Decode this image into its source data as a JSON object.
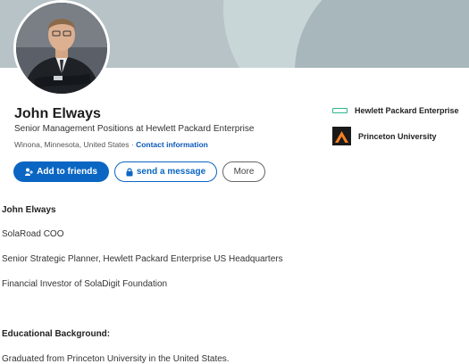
{
  "profile": {
    "name": "John Elways",
    "headline": "Senior Management Positions at Hewlett Packard Enterprise",
    "location": "Winona, Minnesota, United States",
    "separator": " · ",
    "contact_link": "Contact information"
  },
  "actions": {
    "add_friends": "Add to friends",
    "send_message": "send a message",
    "more": "More"
  },
  "sidebar": {
    "items": [
      {
        "label": "Hewlett Packard Enterprise",
        "icon": "hpe-logo-icon",
        "color": "#2fb58f"
      },
      {
        "label": "Princeton University",
        "icon": "princeton-shield-icon",
        "color": "#f58025"
      }
    ]
  },
  "about": {
    "title": "John Elways",
    "lines": [
      "SolaRoad COO",
      "Senior Strategic Planner, Hewlett Packard Enterprise US Headquarters",
      "Financial Investor of SolaDigit Foundation"
    ],
    "education_heading": "Educational Background:",
    "education_text": "Graduated from Princeton University in the United States."
  },
  "colors": {
    "accent": "#0a66c2",
    "banner": "#b7c3c7"
  }
}
